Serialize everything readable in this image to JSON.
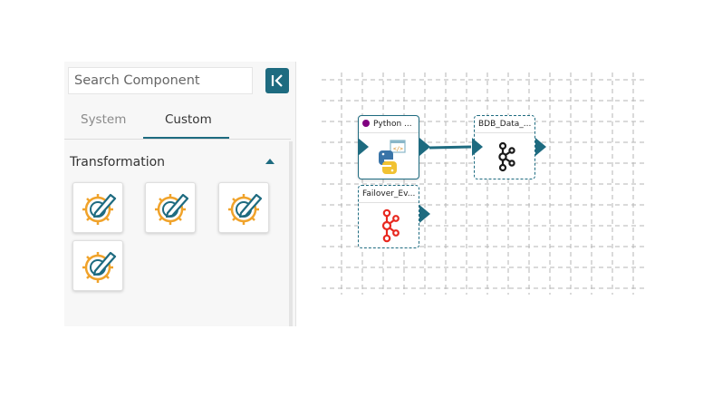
{
  "panel": {
    "search": {
      "placeholder": "Search Component"
    },
    "tabs": [
      {
        "label": "System",
        "active": false
      },
      {
        "label": "Custom",
        "active": true
      }
    ],
    "section": {
      "title": "Transformation",
      "expanded": true
    },
    "components": [
      {
        "icon": "transformation-gear-pencil-icon"
      },
      {
        "icon": "transformation-gear-pencil-icon"
      },
      {
        "icon": "transformation-gear-pencil-icon"
      },
      {
        "icon": "transformation-gear-pencil-icon"
      }
    ]
  },
  "canvas": {
    "nodes": [
      {
        "title": "Python ...",
        "icon": "python-script-icon",
        "status": "running",
        "selected": true
      },
      {
        "title": "BDB_Data_...",
        "icon": "kafka-icon",
        "selected": false
      },
      {
        "title": "Failover_Ev...",
        "icon": "kafka-icon-red",
        "selected": false
      }
    ],
    "edges": [
      {
        "from": "Python ...",
        "to": "BDB_Data_..."
      }
    ]
  },
  "colors": {
    "accent": "#1e6b80",
    "gear_orange": "#f0a32b",
    "pencil_blue": "#1e6b80",
    "status_purple": "#800080",
    "kafka_red": "#e8281f"
  }
}
